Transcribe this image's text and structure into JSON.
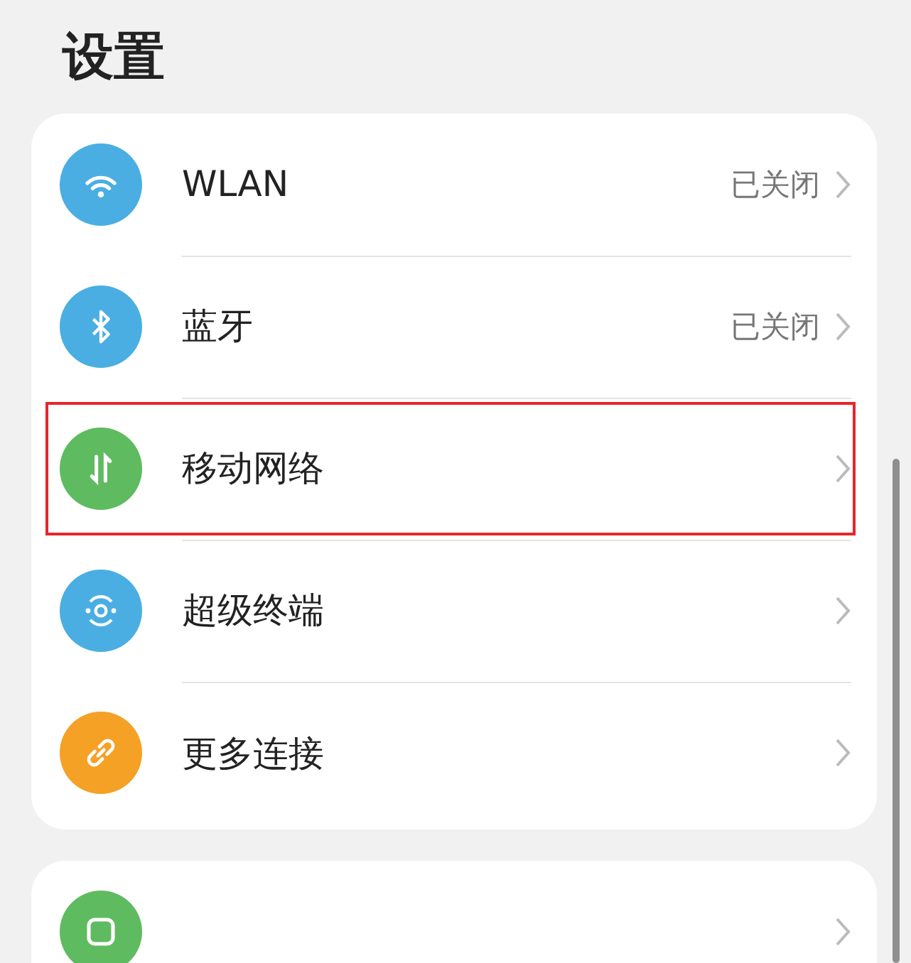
{
  "title": "设置",
  "groups": [
    {
      "items": [
        {
          "label": "WLAN",
          "value": "已关闭",
          "color": "#4aaee3",
          "highlighted": false
        },
        {
          "label": "蓝牙",
          "value": "已关闭",
          "color": "#4aaee3",
          "highlighted": false
        },
        {
          "label": "移动网络",
          "color": "#5fbb5f",
          "highlighted": true
        },
        {
          "label": "超级终端",
          "color": "#4aaee3",
          "highlighted": false
        },
        {
          "label": "更多连接",
          "color": "#f4a125",
          "highlighted": false
        }
      ]
    },
    {
      "items": [
        {
          "color": "#5fbb5f",
          "highlighted": false
        }
      ]
    }
  ]
}
